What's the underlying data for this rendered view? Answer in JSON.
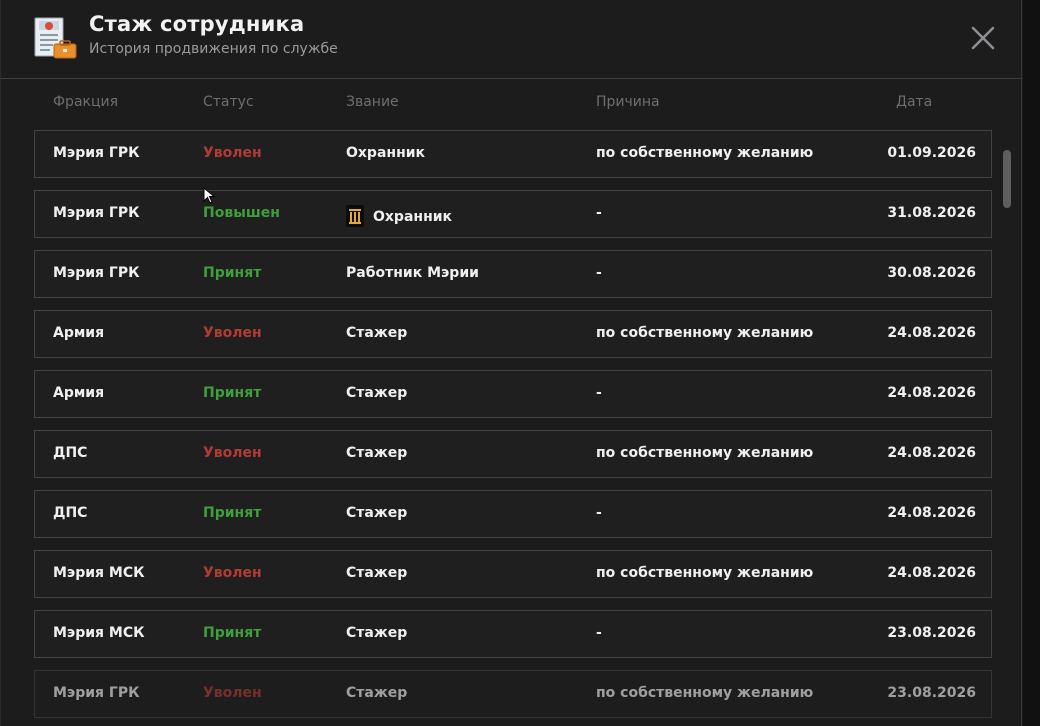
{
  "window": {
    "title": "Стаж сотрудника",
    "subtitle": "История продвижения по службе"
  },
  "icons": {
    "document": "document-briefcase-icon",
    "close": "close-icon",
    "rank": "rank-badge-icon"
  },
  "colors": {
    "fired": "#b13c36",
    "hired": "#3f9f3a",
    "promoted": "#3f9f3a"
  },
  "columns": {
    "faction": "Фракция",
    "status": "Статус",
    "rank": "Звание",
    "reason": "Причина",
    "date": "Дата"
  },
  "rows": [
    {
      "faction": "Мэрия ГРК",
      "status": "Уволен",
      "status_type": "fired",
      "rank": "Охранник",
      "reason": "по собственному желанию",
      "date": "01.09.2026"
    },
    {
      "faction": "Мэрия ГРК",
      "status": "Повышен",
      "status_type": "promoted",
      "rank": "Охранник",
      "reason": "-",
      "date": "31.08.2026"
    },
    {
      "faction": "Мэрия ГРК",
      "status": "Принят",
      "status_type": "hired",
      "rank": "Работник Мэрии",
      "reason": "-",
      "date": "30.08.2026"
    },
    {
      "faction": "Армия",
      "status": "Уволен",
      "status_type": "fired",
      "rank": "Стажер",
      "reason": "по собственному желанию",
      "date": "24.08.2026"
    },
    {
      "faction": "Армия",
      "status": "Принят",
      "status_type": "hired",
      "rank": "Стажер",
      "reason": "-",
      "date": "24.08.2026"
    },
    {
      "faction": "ДПС",
      "status": "Уволен",
      "status_type": "fired",
      "rank": "Стажер",
      "reason": "по собственному желанию",
      "date": "24.08.2026"
    },
    {
      "faction": "ДПС",
      "status": "Принят",
      "status_type": "hired",
      "rank": "Стажер",
      "reason": "-",
      "date": "24.08.2026"
    },
    {
      "faction": "Мэрия МСК",
      "status": "Уволен",
      "status_type": "fired",
      "rank": "Стажер",
      "reason": "по собственному желанию",
      "date": "24.08.2026"
    },
    {
      "faction": "Мэрия МСК",
      "status": "Принят",
      "status_type": "hired",
      "rank": "Стажер",
      "reason": "-",
      "date": "23.08.2026"
    },
    {
      "faction": "Мэрия ГРК",
      "status": "Уволен",
      "status_type": "fired",
      "rank": "Стажер",
      "reason": "по собственному желанию",
      "date": "23.08.2026"
    }
  ]
}
